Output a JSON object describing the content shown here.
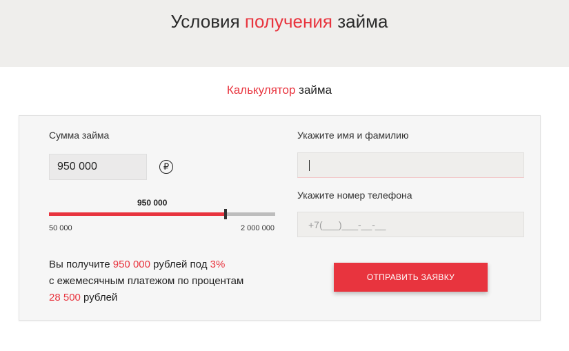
{
  "header": {
    "title_part1": "Условия ",
    "title_accent": "получения",
    "title_part2": " займа"
  },
  "calculator": {
    "title_accent": "Калькулятор",
    "title_rest": " займа",
    "amount_label": "Сумма займа",
    "amount_value": "950 000",
    "currency_symbol": "₽",
    "slider": {
      "value_label": "950 000",
      "min_label": "50 000",
      "max_label": "2 000 000",
      "value": 950000,
      "min": 50000,
      "max": 2000000
    },
    "summary": {
      "t1": "Вы получите ",
      "amount": "950 000",
      "t2": " рублей под ",
      "rate": "3%",
      "t3": "с ежемесячным платежом по процентам",
      "payment": "28 500",
      "t4": " рублей"
    }
  },
  "form": {
    "name_label": "Укажите имя и фамилию",
    "name_value": "",
    "phone_label": "Укажите номер телефона",
    "phone_placeholder": "+7(___)___-__-__",
    "submit_label": "ОТПРАВИТЬ ЗАЯВКУ"
  },
  "colors": {
    "accent": "#e8343e",
    "band": "#efeeec",
    "card": "#f6f6f6"
  }
}
